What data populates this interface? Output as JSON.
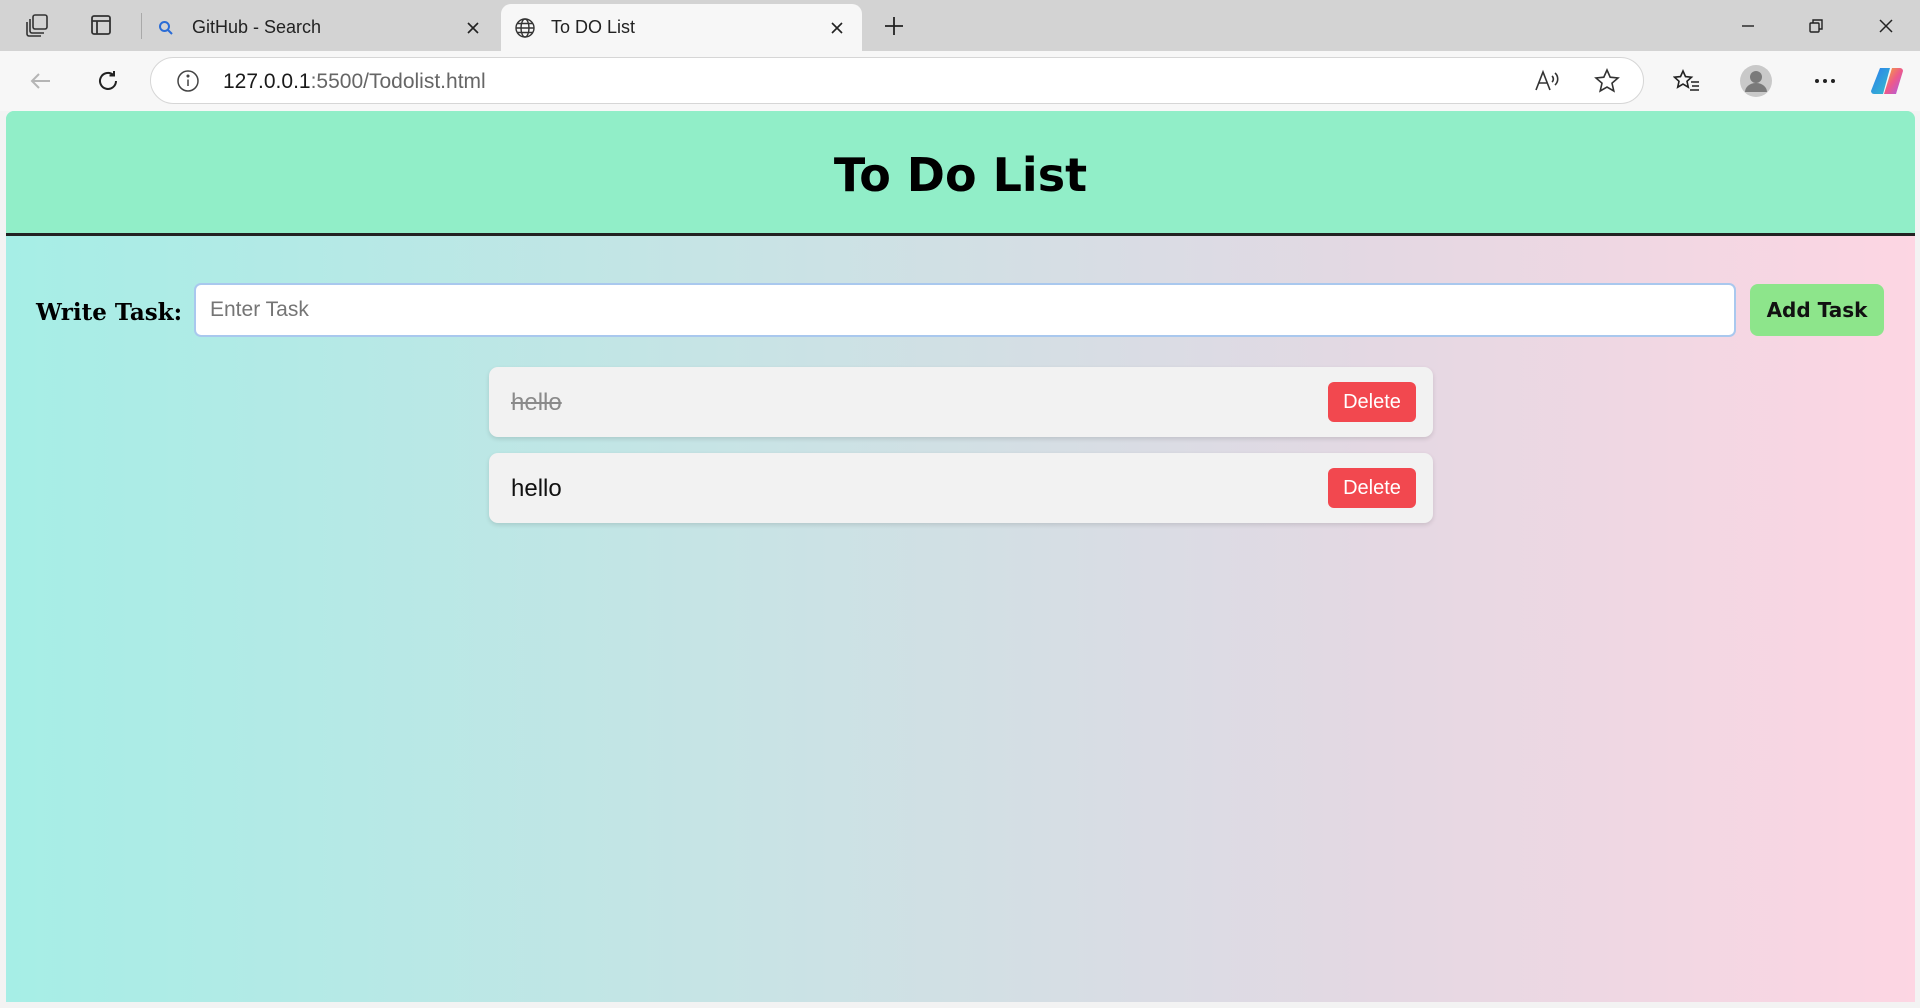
{
  "browser": {
    "tabs": [
      {
        "title": "GitHub - Search",
        "active": false
      },
      {
        "title": "To DO List",
        "active": true
      }
    ],
    "address": {
      "host": "127.0.0.1",
      "path": ":5500/Todolist.html"
    }
  },
  "page": {
    "heading": "To Do List",
    "input_label": "Write Task:",
    "input_placeholder": "Enter Task",
    "input_value": "",
    "add_button": "Add Task",
    "tasks": [
      {
        "text": "hello",
        "completed": true,
        "delete_label": "Delete"
      },
      {
        "text": "hello",
        "completed": false,
        "delete_label": "Delete"
      }
    ]
  },
  "colors": {
    "header_bg": "#91eec8",
    "add_button": "#8de58b",
    "delete_button": "#f2484f",
    "gradient_left": "#a6eee6",
    "gradient_right": "#fdd6e3"
  },
  "icons": {
    "tab_strip": [
      "workspaces-icon",
      "tab-actions-icon"
    ],
    "toolbar": [
      "back-icon",
      "refresh-icon",
      "info-icon",
      "read-aloud-icon",
      "favorite-star-icon",
      "favorites-icon",
      "profile-icon",
      "more-icon",
      "copilot-icon"
    ]
  }
}
